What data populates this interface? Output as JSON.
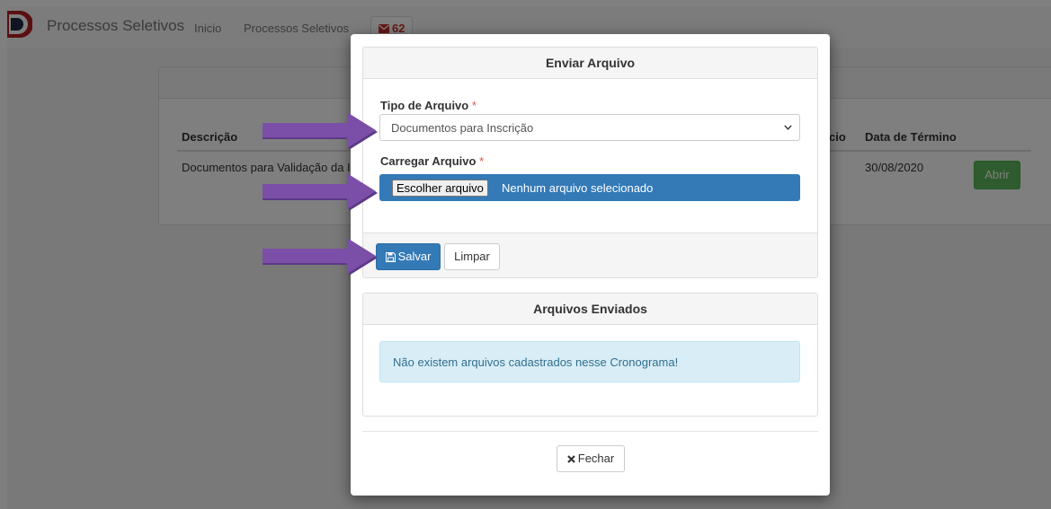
{
  "navbar": {
    "brand": "Processos Seletivos",
    "links": [
      "Inicio",
      "Processos Seletivos"
    ],
    "badge_count": "62",
    "badge_icon": "envelope-icon"
  },
  "table": {
    "headers": {
      "descricao": "Descrição",
      "inicio_partial": "cio",
      "termino": "Data de Término"
    },
    "row": {
      "descricao": "Documentos para Validação da In",
      "termino": "30/08/2020",
      "action": "Abrir"
    }
  },
  "modal": {
    "upload_card": {
      "title": "Enviar Arquivo",
      "tipo_label": "Tipo de Arquivo",
      "carregar_label": "Carregar Arquivo",
      "required_mark": "*",
      "tipo_selected": "Documentos para Inscrição",
      "file_button": "Escolher arquivo",
      "file_status": "Nenhum arquivo selecionado",
      "save_label": "Salvar",
      "clear_label": "Limpar"
    },
    "sent_card": {
      "title": "Arquivos Enviados",
      "empty_message": "Não existem arquivos cadastrados nesse Cronograma!"
    },
    "close_label": "Fechar"
  },
  "colors": {
    "primary": "#337ab7",
    "success": "#5cb85c",
    "danger": "#d9534f",
    "info_bg": "#d9edf7",
    "arrow": "#7b4fa8"
  }
}
